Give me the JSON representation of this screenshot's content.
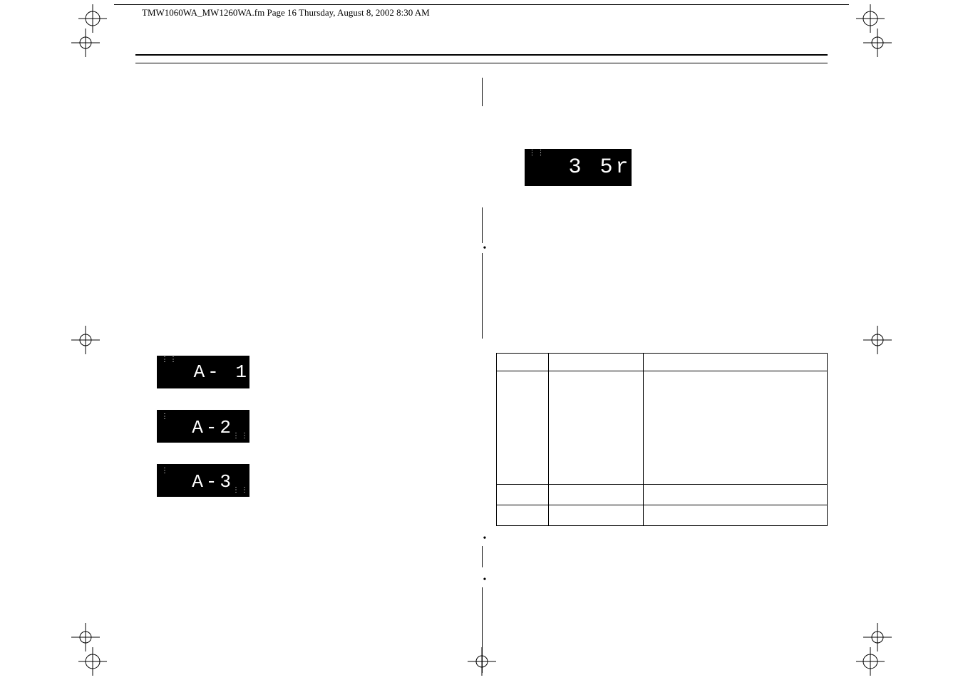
{
  "header_note": "TMW1060WA_MW1260WA.fm  Page 16  Thursday, August 8, 2002  8:30 AM",
  "left": {
    "display1": "A- 1",
    "display2": "A-2",
    "display3": "A-3"
  },
  "right": {
    "display": "3 5r",
    "table": {
      "headers": [
        "",
        "",
        ""
      ],
      "rows": [
        {
          "c1": "",
          "c2": "",
          "c3": ""
        },
        {
          "c1": "",
          "c2": "",
          "c3": ""
        },
        {
          "c1": "",
          "c2": "",
          "c3": ""
        }
      ]
    }
  }
}
